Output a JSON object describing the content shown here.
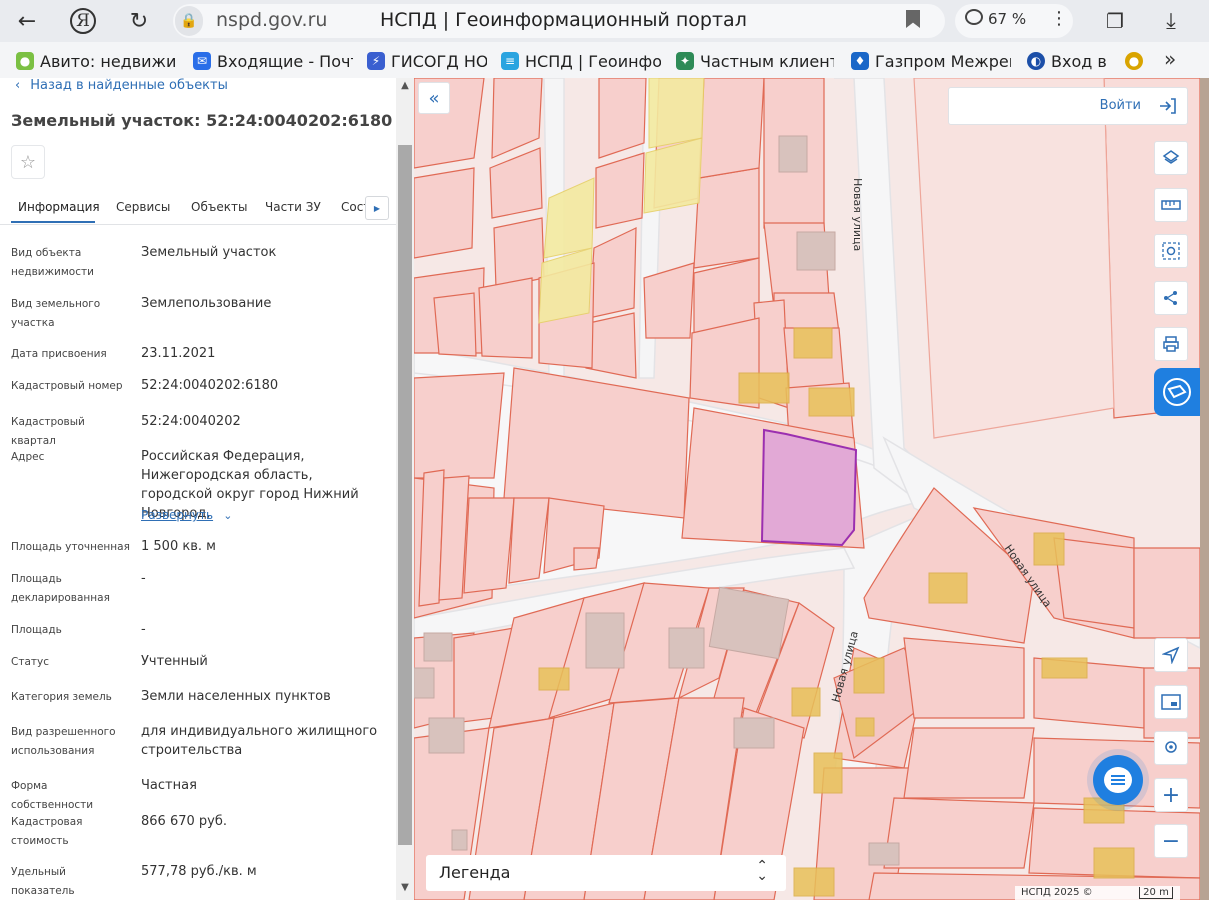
{
  "browser": {
    "url": "nspd.gov.ru",
    "title": "НСПД | Геоинформационный портал",
    "zoom": "67 %",
    "bookmarks": [
      {
        "label": "Авито: недвижим",
        "icon": "avito-icon",
        "color": "#7bc043"
      },
      {
        "label": "Входящие - Почта",
        "icon": "mail-icon",
        "color": "#2a6ee8"
      },
      {
        "label": "ГИСОГД НО",
        "icon": "gisogd-icon",
        "color": "#3a5fd0"
      },
      {
        "label": "НСПД | Геоинфор",
        "icon": "nspd-icon",
        "color": "#2aa4e0"
      },
      {
        "label": "Частным клиента",
        "icon": "bank-icon",
        "color": "#2e8b57"
      },
      {
        "label": "Газпром Межреги",
        "icon": "gazprom-icon",
        "color": "#1a67c8"
      },
      {
        "label": "Вход в с",
        "icon": "login-site-icon",
        "color": "#1c4fa8"
      }
    ]
  },
  "panel": {
    "back_label": "Назад в найденные объекты",
    "title": "Земельный участок: 52:24:0040202:6180",
    "tabs": [
      "Информация",
      "Сервисы",
      "Объекты",
      "Части ЗУ",
      "Сост"
    ],
    "active_tab": "Информация",
    "expand_label": "Развернуть",
    "fields": [
      {
        "label": "Вид объекта недвижимости",
        "value": "Земельный участок"
      },
      {
        "label": "Вид земельного участка",
        "value": "Землепользование"
      },
      {
        "label": "Дата присвоения",
        "value": "23.11.2021"
      },
      {
        "label": "Кадастровый номер",
        "value": "52:24:0040202:6180"
      },
      {
        "label": "Кадастровый квартал",
        "value": "52:24:0040202"
      },
      {
        "label": "Адрес",
        "value": "Российская Федерация, Нижегородская область, городской округ город Нижний Новгород,"
      },
      {
        "label": "Площадь уточненная",
        "value": "1 500 кв. м"
      },
      {
        "label": "Площадь декларированная",
        "value": "-"
      },
      {
        "label": "Площадь",
        "value": "-"
      },
      {
        "label": "Статус",
        "value": "Учтенный"
      },
      {
        "label": "Категория земель",
        "value": "Земли населенных пунктов"
      },
      {
        "label": "Вид разрешенного использования",
        "value": "для индивидуального жилищного строительства"
      },
      {
        "label": "Форма собственности",
        "value": "Частная"
      },
      {
        "label": "Кадастровая стоимость",
        "value": "866 670 руб."
      },
      {
        "label": "Удельный показатель кадастровой",
        "value": "577,78 руб./кв. м"
      }
    ]
  },
  "map": {
    "login_label": "Войти",
    "legend_label": "Легенда",
    "copyright": "НСПД 2025 ©",
    "scale": "20 m",
    "street_label": "Новая улица",
    "colors": {
      "parcel_fill": "#f7cfcc",
      "parcel_line": "#e06a55",
      "road": "#f6f6f7",
      "building": "#e8c15a",
      "selected_fill": "#e2a9d6",
      "selected_line": "#9b2fb0",
      "accent": "#2f6fb5"
    }
  }
}
